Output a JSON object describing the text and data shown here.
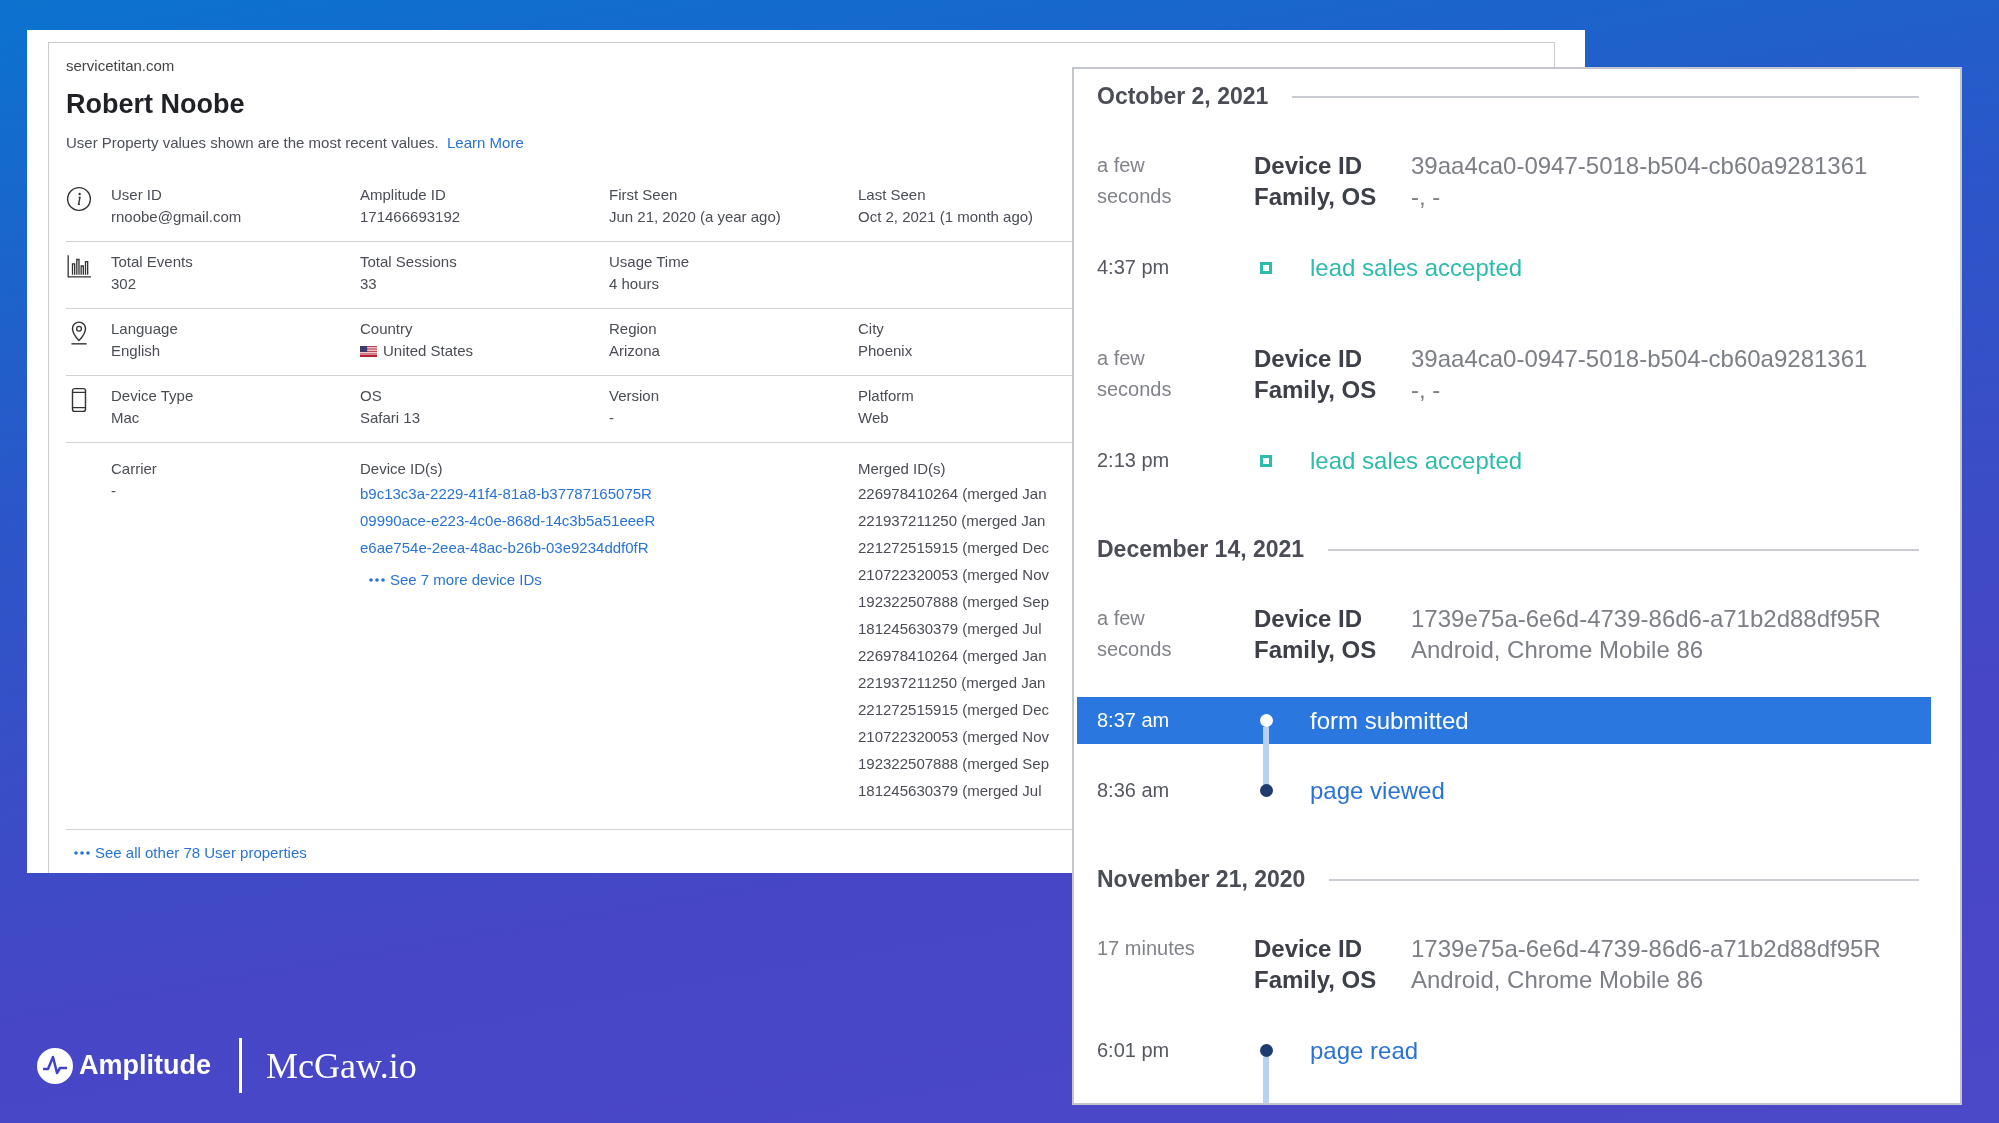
{
  "profile": {
    "domain": "servicetitan.com",
    "name": "Robert Noobe",
    "note": "User Property values shown are the most recent values.",
    "note_link": "Learn More",
    "rows": [
      {
        "kind": "info",
        "cells": [
          {
            "kind": "text",
            "label": "User ID",
            "value": "rnoobe@gmail.com"
          },
          {
            "kind": "text",
            "label": "Amplitude ID",
            "value": "171466693192"
          },
          {
            "kind": "text",
            "label": "First Seen",
            "value": "Jun 21, 2020 (a year ago)"
          },
          {
            "kind": "text",
            "label": "Last Seen",
            "value": "Oct 2, 2021 (1 month ago)"
          }
        ]
      },
      {
        "kind": "chart",
        "cells": [
          {
            "kind": "text",
            "label": "Total Events",
            "value": "302"
          },
          {
            "kind": "text",
            "label": "Total Sessions",
            "value": "33"
          },
          {
            "kind": "text",
            "label": "Usage Time",
            "value": "4 hours"
          }
        ]
      },
      {
        "kind": "pin",
        "cells": [
          {
            "kind": "text",
            "label": "Language",
            "value": "English"
          },
          {
            "kind": "country",
            "label": "Country",
            "value": "United States"
          },
          {
            "kind": "text",
            "label": "Region",
            "value": "Arizona"
          },
          {
            "kind": "text",
            "label": "City",
            "value": "Phoenix"
          }
        ]
      },
      {
        "kind": "phone",
        "cells": [
          {
            "kind": "text",
            "label": "Device Type",
            "value": "Mac"
          },
          {
            "kind": "text",
            "label": "OS",
            "value": "Safari 13"
          },
          {
            "kind": "text",
            "label": "Version",
            "value": "-"
          },
          {
            "kind": "text",
            "label": "Platform",
            "value": "Web"
          }
        ]
      },
      {
        "cells": [
          {
            "kind": "text",
            "label": "Carrier",
            "value": "-"
          },
          {
            "kind": "links",
            "label": "Device ID(s)",
            "links": [
              "b9c13c3a-2229-41f4-81a8-b37787165075R",
              "09990ace-e223-4c0e-868d-14c3b5a51eeeR",
              "e6ae754e-2eea-48ac-b26b-03e9234ddf0fR"
            ],
            "more": "See 7 more device IDs"
          },
          {
            "kind": "empty"
          },
          {
            "kind": "list",
            "label": "Merged ID(s)",
            "lines": [
              "226978410264 (merged Jan",
              "221937211250 (merged Jan",
              "221272515915 (merged Dec",
              "210722320053 (merged Nov",
              "192322507888 (merged Sep",
              "181245630379 (merged Jul",
              "226978410264 (merged Jan",
              "221937211250 (merged Jan",
              "221272515915 (merged Dec",
              "210722320053 (merged Nov",
              "192322507888 (merged Sep",
              "181245630379 (merged Jul"
            ]
          }
        ]
      }
    ],
    "footer_link": "See all other 78 User properties"
  },
  "timeline": {
    "sections": [
      {
        "date": "October 2, 2021",
        "sessions": [
          {
            "duration": "a few seconds",
            "device_label": "Device ID",
            "device_id": "39aa4ca0-0947-5018-b504-cb60a9281361",
            "family_label": "Family, OS",
            "family_os": "-, -",
            "events": [
              {
                "time": "4:37 pm",
                "name": "lead sales accepted",
                "kind": "custom",
                "selected": false,
                "trail": false
              }
            ]
          },
          {
            "duration": "a few seconds",
            "device_label": "Device ID",
            "device_id": "39aa4ca0-0947-5018-b504-cb60a9281361",
            "family_label": "Family, OS",
            "family_os": "-, -",
            "events": [
              {
                "time": "2:13 pm",
                "name": "lead sales accepted",
                "kind": "custom",
                "selected": false,
                "trail": false
              }
            ]
          }
        ]
      },
      {
        "date": "December 14, 2021",
        "sessions": [
          {
            "duration": "a few seconds",
            "device_label": "Device ID",
            "device_id": "1739e75a-6e6d-4739-86d6-a71b2d88df95R",
            "family_label": "Family, OS",
            "family_os": "Android, Chrome Mobile 86",
            "events": [
              {
                "time": "8:37 am",
                "name": "form submitted",
                "kind": "standard",
                "selected": true,
                "trail": true
              },
              {
                "time": "8:36 am",
                "name": "page viewed",
                "kind": "standard",
                "selected": false,
                "trail": false
              }
            ]
          }
        ]
      },
      {
        "date": "November 21, 2020",
        "sessions": [
          {
            "duration": "17 minutes",
            "device_label": "Device ID",
            "device_id": "1739e75a-6e6d-4739-86d6-a71b2d88df95R",
            "family_label": "Family, OS",
            "family_os": "Android, Chrome Mobile 86",
            "events": [
              {
                "time": "6:01 pm",
                "name": "page read",
                "kind": "standard",
                "selected": false,
                "trail": true
              }
            ]
          }
        ]
      }
    ]
  },
  "brand": {
    "left": "Amplitude",
    "right": "McGaw.io"
  }
}
